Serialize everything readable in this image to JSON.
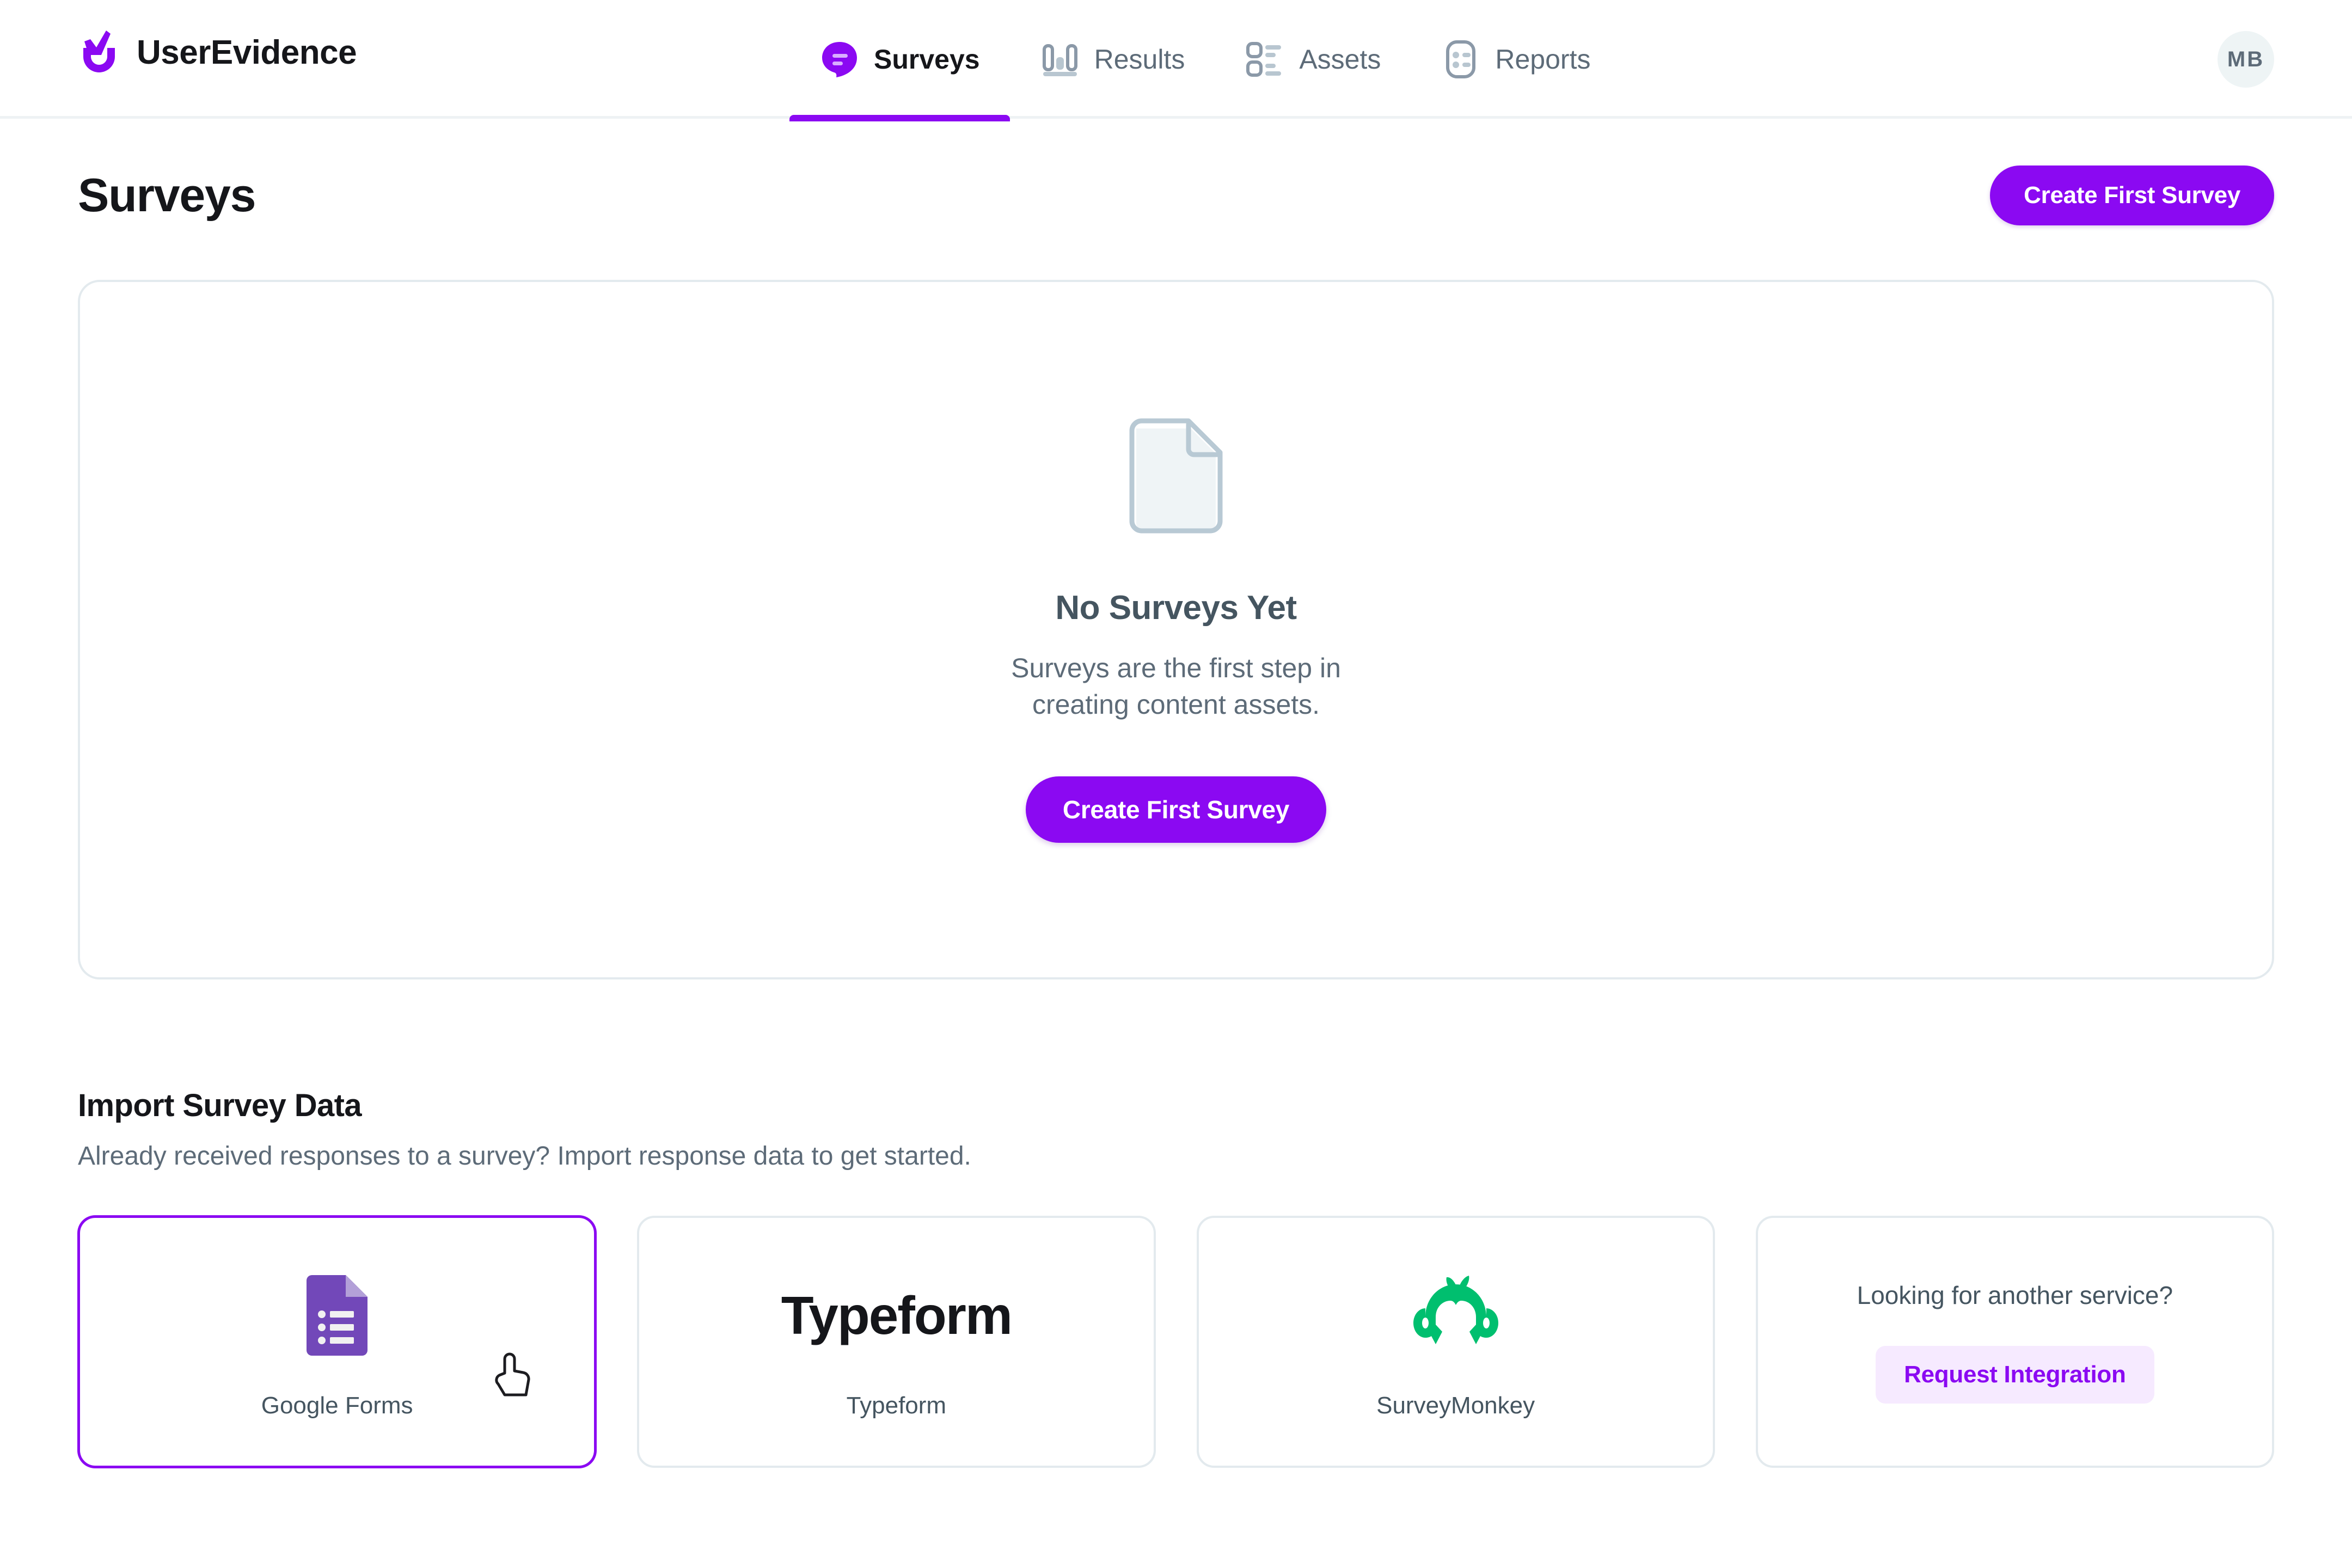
{
  "header": {
    "brand_name": "UserEvidence",
    "brand_logo_icon": "userevidence-check-logo",
    "avatar_initials": "MB",
    "tabs": [
      {
        "label": "Surveys",
        "icon": "speech-bubble-icon",
        "active": true
      },
      {
        "label": "Results",
        "icon": "bar-chart-icon",
        "active": false
      },
      {
        "label": "Assets",
        "icon": "checklist-icon",
        "active": false
      },
      {
        "label": "Reports",
        "icon": "report-card-icon",
        "active": false
      }
    ]
  },
  "page": {
    "title": "Surveys",
    "header_button_label": "Create First Survey"
  },
  "empty_state": {
    "icon": "document-page-icon",
    "title": "No Surveys Yet",
    "subtitle": "Surveys are the first step in creating content assets.",
    "cta_label": "Create First Survey"
  },
  "import": {
    "title": "Import Survey Data",
    "subtitle": "Already received responses to a survey? Import response data to get started.",
    "cards": [
      {
        "label": "Google Forms",
        "logo": "google-forms-icon",
        "selected": true
      },
      {
        "label": "Typeform",
        "logo": "typeform-wordmark",
        "wordmark": "Typeform",
        "selected": false
      },
      {
        "label": "SurveyMonkey",
        "logo": "surveymonkey-icon",
        "selected": false
      }
    ],
    "request_card": {
      "question": "Looking for another service?",
      "button_label": "Request Integration"
    }
  },
  "cursor": {
    "icon": "pointing-hand-cursor"
  },
  "colors": {
    "accent_purple": "#8b09f2",
    "ghost_purple_bg": "#f6eaff",
    "text_dark": "#15161a",
    "text_muted": "#5d6b78",
    "border": "#e3eaee",
    "surveymonkey_green": "#00bf6f",
    "google_forms_purple": "#7248b9"
  }
}
